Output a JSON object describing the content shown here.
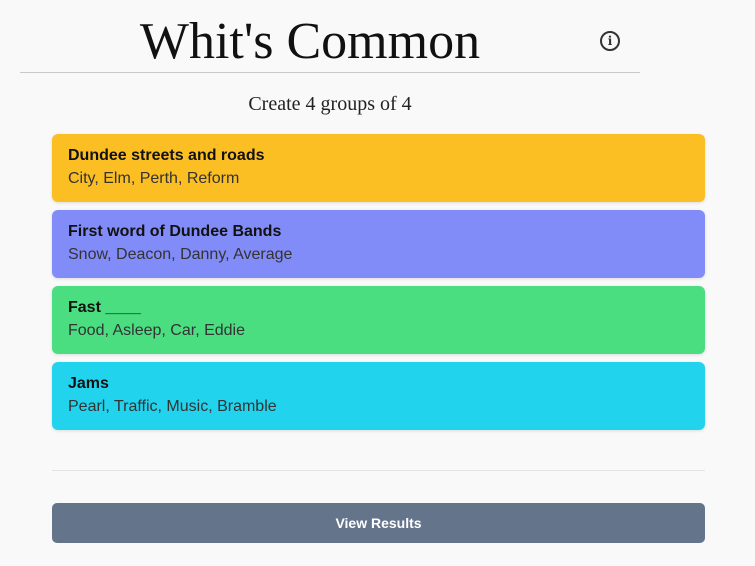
{
  "header": {
    "title": "Whit's Common",
    "info_icon": "info-icon"
  },
  "subtitle": "Create 4 groups of 4",
  "groups": [
    {
      "title": "Dundee streets and roads",
      "members": "City, Elm, Perth, Reform",
      "color": "#fbbf24"
    },
    {
      "title": "First word of Dundee Bands",
      "members": "Snow, Deacon, Danny, Average",
      "color": "#818cf8"
    },
    {
      "title": "Fast ____",
      "members": "Food, Asleep, Car, Eddie",
      "color": "#4ade80"
    },
    {
      "title": "Jams",
      "members": "Pearl, Traffic, Music, Bramble",
      "color": "#22d3ee"
    }
  ],
  "actions": {
    "view_results_label": "View Results",
    "button_color": "#64748b"
  }
}
